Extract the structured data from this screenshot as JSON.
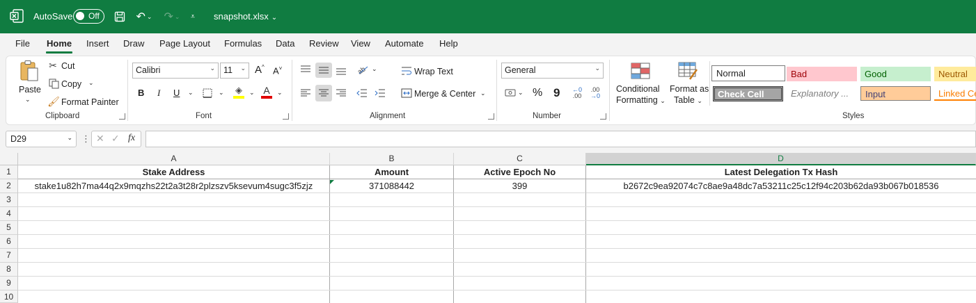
{
  "titlebar": {
    "autosave_label": "AutoSave",
    "autosave_state": "Off",
    "filename": "snapshot.xlsx",
    "bg_color": "#107c41"
  },
  "menu": {
    "tabs": [
      "File",
      "Home",
      "Insert",
      "Draw",
      "Page Layout",
      "Formulas",
      "Data",
      "Review",
      "View",
      "Automate",
      "Help"
    ],
    "active": "Home"
  },
  "ribbon": {
    "clipboard": {
      "paste": "Paste",
      "cut": "Cut",
      "copy": "Copy",
      "format_painter": "Format Painter",
      "label": "Clipboard"
    },
    "font": {
      "name": "Calibri",
      "size": "11",
      "grow": "A",
      "shrink": "A",
      "bold": "B",
      "italic": "I",
      "underline": "U",
      "color_letter": "A",
      "label": "Font"
    },
    "alignment": {
      "wrap_text": "Wrap Text",
      "merge_center": "Merge & Center",
      "label": "Alignment"
    },
    "number": {
      "format": "General",
      "percent": "%",
      "comma": "9",
      "label": "Number"
    },
    "styles": {
      "conditional_formatting_1": "Conditional",
      "conditional_formatting_2": "Formatting",
      "format_as_table_1": "Format as",
      "format_as_table_2": "Table",
      "normal": "Normal",
      "bad": "Bad",
      "good": "Good",
      "neutral": "Neutral",
      "check_cell": "Check Cell",
      "explanatory": "Explanatory ...",
      "input": "Input",
      "linked_cell": "Linked Ce",
      "label": "Styles"
    }
  },
  "formula_bar": {
    "name_box": "D29",
    "fx": "fx",
    "content": ""
  },
  "sheet": {
    "columns": [
      "A",
      "B",
      "C",
      "D"
    ],
    "selected_column": "D",
    "row_numbers": [
      "1",
      "2",
      "3",
      "4",
      "5",
      "6",
      "7",
      "8",
      "9",
      "10"
    ],
    "headers": [
      "Stake Address",
      "Amount",
      "Active Epoch No",
      "Latest Delegation Tx Hash"
    ],
    "rows": [
      [
        "stake1u82h7ma44q2x9mqzhs22t2a3t28r2plzszv5ksevum4sugc3f5zjz",
        "371088442",
        "399",
        "b2672c9ea92074c7c8ae9a48dc7a53211c25c12f94c203b62da93b067b018536"
      ]
    ]
  }
}
